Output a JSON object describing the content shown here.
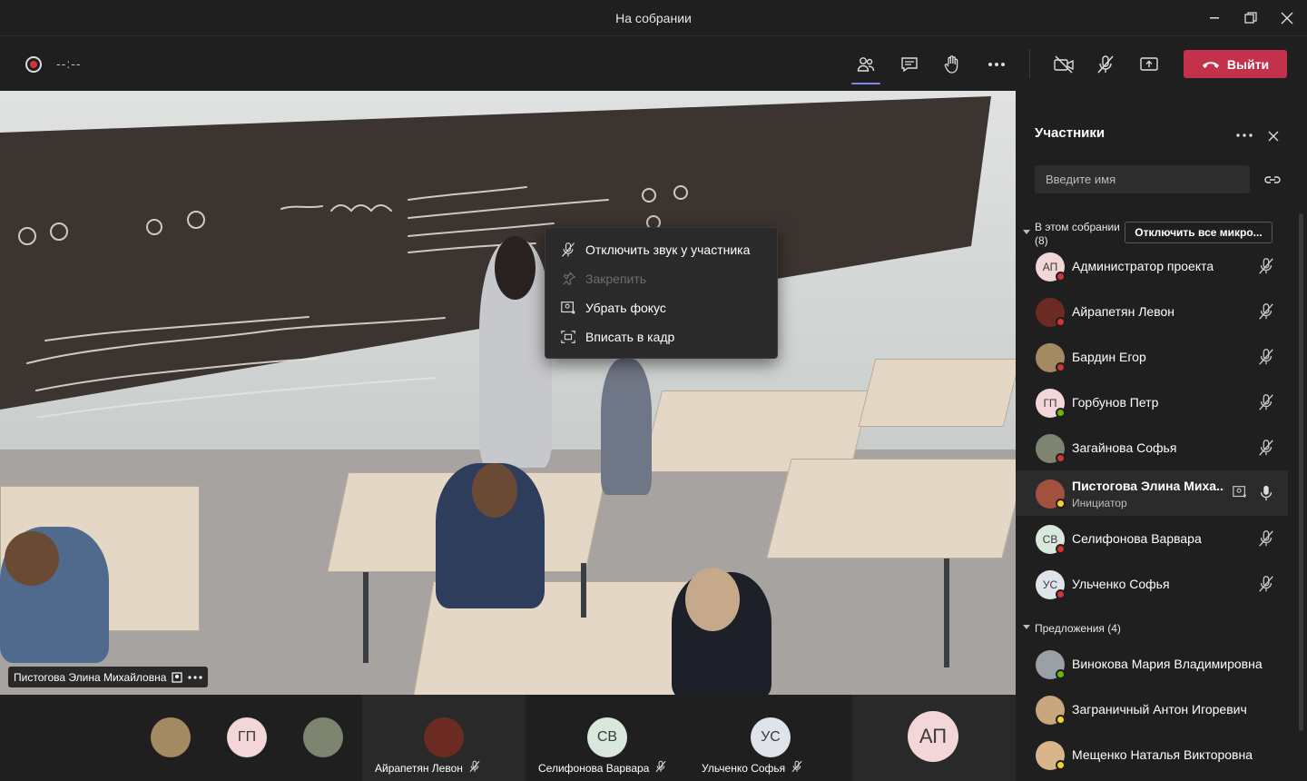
{
  "window": {
    "title": "На собрании"
  },
  "toolbar": {
    "timer": "--:--",
    "leave_label": "Выйти"
  },
  "video": {
    "speaker_name": "Пистогова Элина Михайловна"
  },
  "context_menu": {
    "items": [
      {
        "label": "Отключить звук у участника",
        "icon": "mic-off-icon",
        "disabled": false
      },
      {
        "label": "Закрепить",
        "icon": "pin-icon",
        "disabled": true
      },
      {
        "label": "Убрать фокус",
        "icon": "unspotlight-icon",
        "disabled": false
      },
      {
        "label": "Вписать в кадр",
        "icon": "fit-frame-icon",
        "disabled": false
      }
    ]
  },
  "panel": {
    "title": "Участники",
    "search_placeholder": "Введите имя",
    "in_meeting_label": "В этом собрании",
    "in_meeting_count": "(8)",
    "mute_all_label": "Отключить все микро...",
    "suggestions_label": "Предложения (4)",
    "participants": [
      {
        "initials": "АП",
        "name": "Администратор проекта",
        "role": "",
        "status": "busy",
        "mic": "muted",
        "avatar_bg": "#f3d6d8"
      },
      {
        "initials": "",
        "name": "Айрапетян Левон",
        "role": "",
        "status": "busy",
        "mic": "muted",
        "avatar_bg": "#6b2a22"
      },
      {
        "initials": "",
        "name": "Бардин Егор",
        "role": "",
        "status": "busy",
        "mic": "muted",
        "avatar_bg": "#a48a63"
      },
      {
        "initials": "ГП",
        "name": "Горбунов Петр",
        "role": "",
        "status": "available",
        "mic": "muted",
        "avatar_bg": "#f3d6d8"
      },
      {
        "initials": "",
        "name": "Загайнова Софья",
        "role": "",
        "status": "busy",
        "mic": "muted",
        "avatar_bg": "#7d8470"
      },
      {
        "initials": "",
        "name": "Пистогова Элина Миха...",
        "role": "Инициатор",
        "status": "away",
        "mic": "on",
        "avatar_bg": "#a4503f"
      },
      {
        "initials": "СВ",
        "name": "Селифонова Варвара",
        "role": "",
        "status": "busy",
        "mic": "muted",
        "avatar_bg": "#d8e8dc"
      },
      {
        "initials": "УС",
        "name": "Ульченко Софья",
        "role": "",
        "status": "busy",
        "mic": "muted",
        "avatar_bg": "#dfe3ea"
      }
    ],
    "suggestions": [
      {
        "name": "Винокова Мария Владимировна",
        "status": "available",
        "avatar_bg": "#9aa0a6"
      },
      {
        "name": "Заграничный Антон Игоревич",
        "status": "away",
        "avatar_bg": "#c8a77c"
      },
      {
        "name": "Мещенко Наталья Викторовна",
        "status": "away",
        "avatar_bg": "#d8b58a"
      }
    ]
  },
  "strip": {
    "tiles": [
      {
        "initials": "",
        "name": "",
        "avatar_bg": "#a48a63"
      },
      {
        "initials": "ГП",
        "name": "",
        "avatar_bg": "#f3d6d8"
      },
      {
        "initials": "",
        "name": "",
        "avatar_bg": "#7d8470"
      },
      {
        "initials": "",
        "name": "Айрапетян Левон",
        "avatar_bg": "#6b2a22"
      },
      {
        "initials": "СВ",
        "name": "Селифонова Варвара",
        "avatar_bg": "#d8e8dc"
      },
      {
        "initials": "УС",
        "name": "Ульченко Софья",
        "avatar_bg": "#dfe3ea"
      },
      {
        "initials": "АП",
        "name": "",
        "avatar_bg": "#f3d6d8"
      }
    ]
  },
  "colors": {
    "accent": "#7f85f5",
    "leave": "#c4314b",
    "busy": "#d13438",
    "available": "#6bb700",
    "away": "#f8d22a"
  }
}
